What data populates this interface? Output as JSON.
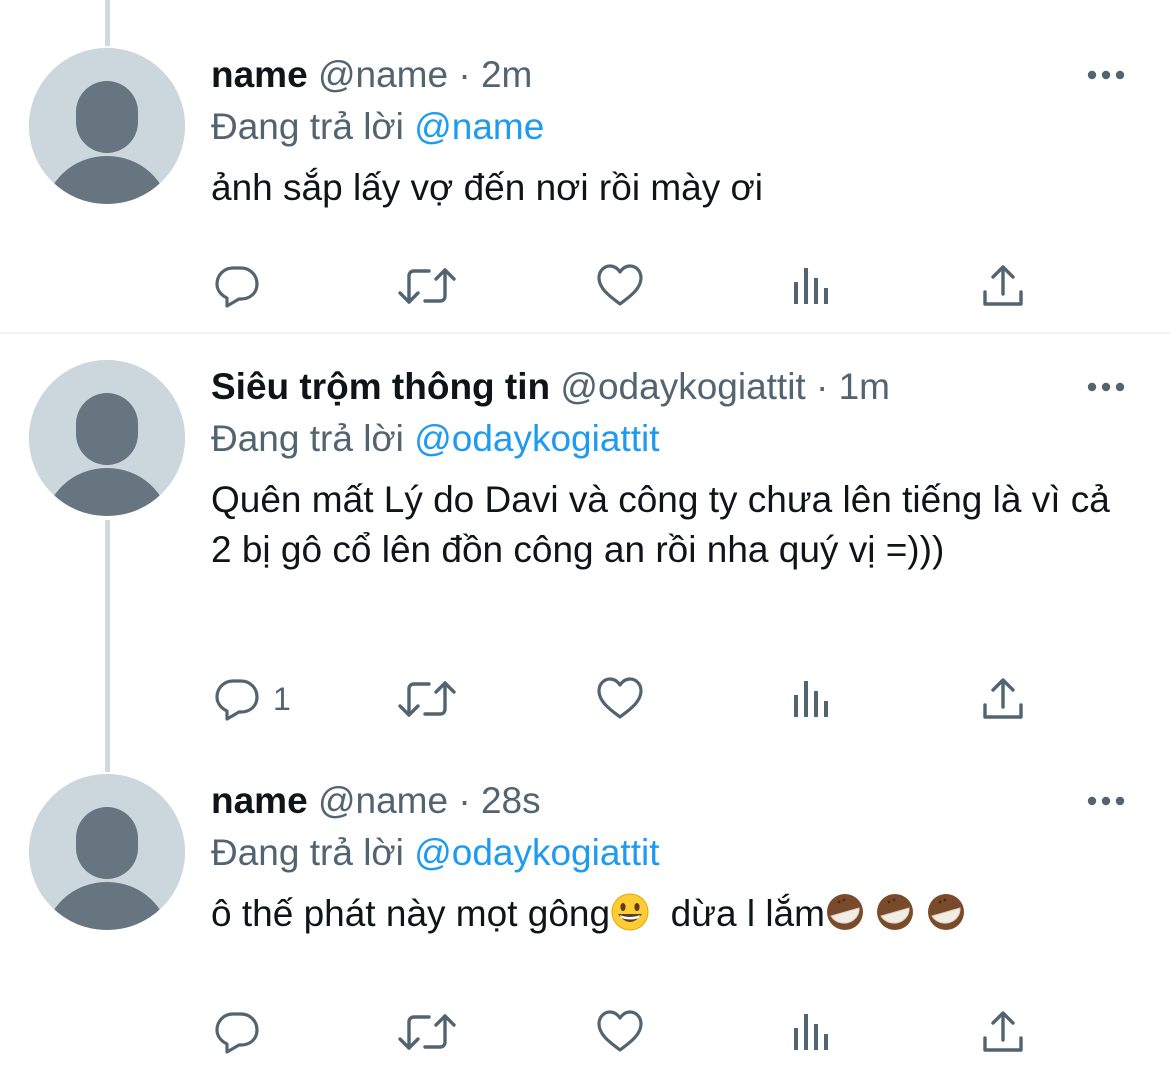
{
  "tweets": [
    {
      "display_name": "name",
      "handle": "@name",
      "separator": "·",
      "time": "2m",
      "replying_label": "Đang trả lời",
      "replying_to": "@name",
      "text": "ảnh sắp lấy vợ đến nơi rồi mày ơi",
      "reply_count": ""
    },
    {
      "display_name": "Siêu trộm thông tin",
      "handle": "@odaykogiattit",
      "separator": "·",
      "time": "1m",
      "replying_label": "Đang trả lời",
      "replying_to": "@odaykogiattit",
      "text": "Quên mất Lý do Davi và công ty chưa lên tiếng là vì cả 2 bị gô cổ lên đồn công an rồi nha quý vị =)))",
      "reply_count": "1"
    },
    {
      "display_name": "name",
      "handle": "@name",
      "separator": "·",
      "time": "28s",
      "replying_label": "Đang trả lời",
      "replying_to": "@odaykogiattit",
      "text_part1": "ô thế phát này mọt gông",
      "text_part2": "  dừa l lắm",
      "emoji_1": "grinning-face",
      "emoji_2": "coconut",
      "reply_count": ""
    }
  ],
  "icons": {
    "more": "more-horizontal-icon",
    "reply": "reply-icon",
    "retweet": "retweet-icon",
    "like": "heart-icon",
    "views": "views-icon",
    "share": "share-icon"
  },
  "colors": {
    "link": "#1d9bf0",
    "secondary_text": "#536471",
    "primary_text": "#0f1419",
    "avatar_bg": "#ccd6dd",
    "avatar_fg": "#66757f",
    "thread_line": "#cfd9de"
  }
}
